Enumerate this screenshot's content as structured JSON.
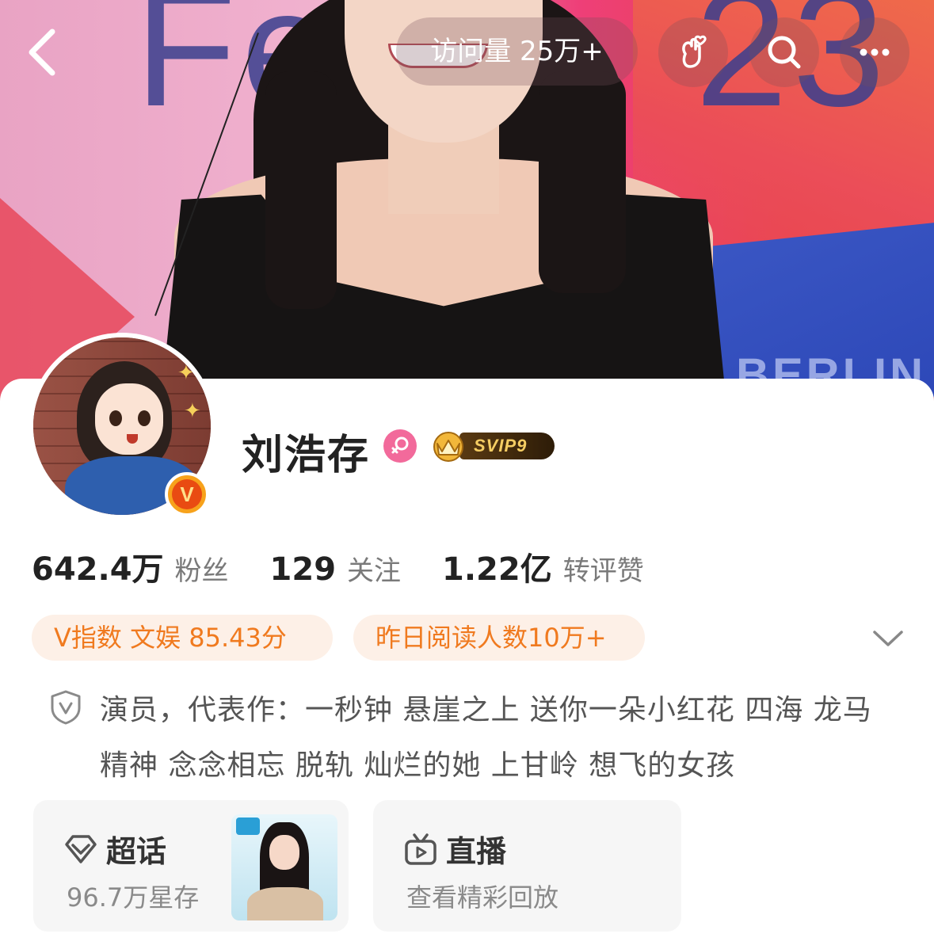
{
  "topbar": {
    "visits_label": "访问量 25万+",
    "icons": [
      "back-arrow-icon",
      "hand-heart-icon",
      "search-icon",
      "more-icon"
    ]
  },
  "profile": {
    "name": "刘浩存",
    "gender": "female",
    "vip_badge": "SVIP9",
    "verified": true,
    "verified_badge_letter": "V"
  },
  "stats": [
    {
      "value": "642.4万",
      "label": "粉丝"
    },
    {
      "value": "129",
      "label": "关注"
    },
    {
      "value": "1.22亿",
      "label": "转评赞"
    }
  ],
  "tags": {
    "v_index": "V指数 文娱 85.43分",
    "reads": "昨日阅读人数10万+"
  },
  "bio": {
    "text": "演员，代表作：一秒钟 悬崖之上 送你一朵小红花 四海 龙马精神 念念相忘 脱轨 灿烂的她 上甘岭 想飞的女孩"
  },
  "cards": {
    "chaohua": {
      "title": "超话",
      "subtitle": "96.7万星存"
    },
    "live": {
      "title": "直播",
      "subtitle": "查看精彩回放"
    }
  },
  "colors": {
    "accent_orange": "#f07a1f",
    "tag_bg": "#fdf0e7",
    "gender_pink": "#f26a9b",
    "verified_orange": "#f7a21b"
  }
}
